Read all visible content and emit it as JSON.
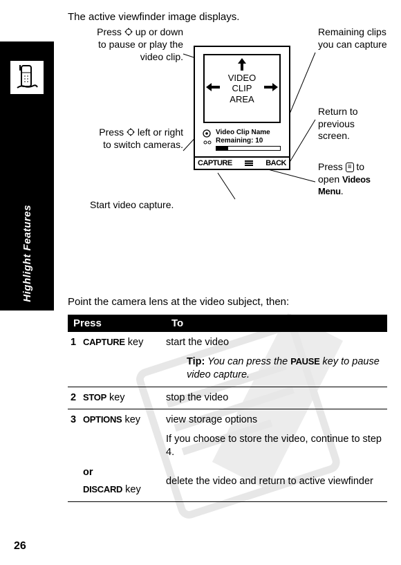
{
  "side_label": "Highlight Features",
  "topline": "The active viewfinder image displays.",
  "callouts": {
    "upleft_a": "Press ",
    "upleft_b": " up or down to pause or play the video clip.",
    "leftmid_a": "Press ",
    "leftmid_b": " left or right to switch cameras.",
    "bottom": "Start video capture.",
    "r1": "Remaining clips you can capture",
    "r2": "Return to previous screen.",
    "r3_a": "Press ",
    "r3_b": " to open ",
    "r3_c": "Videos Menu",
    "r3_d": "."
  },
  "screen": {
    "view_l1": "VIDEO",
    "view_l2": "CLIP",
    "view_l3": "AREA",
    "clipname": "Video Clip Name",
    "remaining": "Remaining: 10",
    "left_soft": "CAPTURE",
    "right_soft": "BACK"
  },
  "lower_intro": "Point the camera lens at the video subject, then:",
  "table": {
    "h1": "Press",
    "h2": "To",
    "rows": [
      {
        "n": "1",
        "key": "CAPTURE",
        "keysuffix": " key",
        "to": "start the video",
        "tip_label": "Tip:",
        "tip_rest": " You can press the ",
        "tip_key": "PAUSE",
        "tip_after": " key to pause video capture."
      },
      {
        "n": "2",
        "key": "STOP",
        "keysuffix": " key",
        "to": "stop the video"
      },
      {
        "n": "3",
        "key": "OPTIONS",
        "keysuffix": " key",
        "to": "view storage options",
        "sub": "If you choose to store the video, continue to step 4.",
        "or": "or",
        "key2": "DISCARD",
        "key2suffix": " key",
        "to2": "delete the video and return to active viewfinder"
      }
    ]
  },
  "page_number": "26"
}
